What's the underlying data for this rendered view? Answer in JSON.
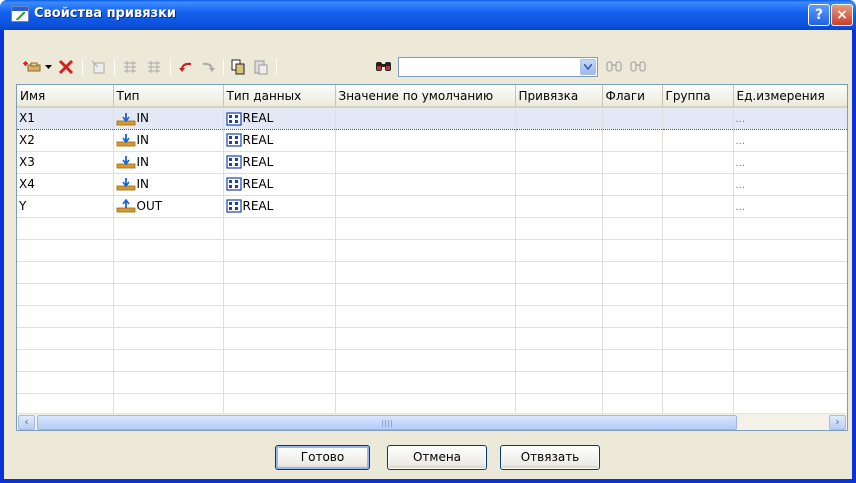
{
  "window": {
    "title": "Свойства привязки",
    "help_label": "?",
    "close_label": "×"
  },
  "toolbar": {
    "search_value": "",
    "icons": [
      "add-variable-icon",
      "dropdown-arrow-icon",
      "delete-icon",
      "import-icon",
      "move-up-icon",
      "move-down-icon",
      "undo-icon",
      "redo-icon",
      "copy-icon",
      "paste-icon",
      "find-icon",
      "find-next-icon",
      "find-prev-icon"
    ]
  },
  "grid": {
    "columns": [
      "Имя",
      "Тип",
      "Тип данных",
      "Значение по умолчанию",
      "Привязка",
      "Флаги",
      "Группа",
      "Ед.измерения"
    ],
    "rows": [
      {
        "name": "X1",
        "type": "IN",
        "datatype": "REAL",
        "unit": "...",
        "selected": true
      },
      {
        "name": "X2",
        "type": "IN",
        "datatype": "REAL",
        "unit": "...",
        "selected": false
      },
      {
        "name": "X3",
        "type": "IN",
        "datatype": "REAL",
        "unit": "...",
        "selected": false
      },
      {
        "name": "X4",
        "type": "IN",
        "datatype": "REAL",
        "unit": "...",
        "selected": false
      },
      {
        "name": "Y",
        "type": "OUT",
        "datatype": "REAL",
        "unit": "...",
        "selected": false
      }
    ],
    "empty_rows": 9
  },
  "buttons": {
    "ok": "Готово",
    "cancel": "Отмена",
    "unbind": "Отвязать"
  },
  "colors": {
    "title_bar": "#0b55e0",
    "selection": "#e3e8f5",
    "client_bg": "#ece9d8",
    "delete_red": "#d42020"
  }
}
